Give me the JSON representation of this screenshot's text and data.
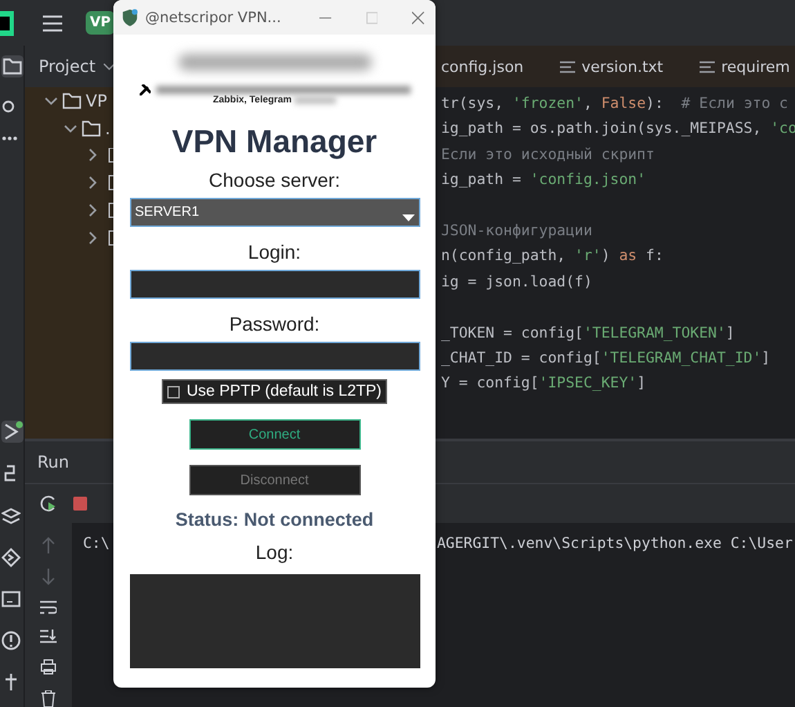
{
  "ide": {
    "top_bar": {
      "project_badge": "VP"
    },
    "project_panel": {
      "title": "Project",
      "tree": [
        {
          "label": "VP",
          "expanded": true,
          "children": [
            {
              "label": ".",
              "expanded": true
            }
          ]
        }
      ]
    },
    "editor": {
      "tabs": [
        {
          "label": "config.json"
        },
        {
          "label": "version.txt"
        },
        {
          "label": "requirem"
        }
      ],
      "lines": [
        {
          "blank_before": false,
          "tokens": [
            {
              "text": "tr(sys, ",
              "kind": "plain"
            },
            {
              "text": "'frozen'",
              "kind": "string"
            },
            {
              "text": ", ",
              "kind": "plain"
            },
            {
              "text": "False",
              "kind": "keyword"
            },
            {
              "text": "):  ",
              "kind": "plain"
            },
            {
              "text": "# Если это с",
              "kind": "comment"
            }
          ]
        },
        {
          "blank_before": false,
          "tokens": [
            {
              "text": "ig_path = os.path.join(sys._MEIPASS, ",
              "kind": "plain"
            },
            {
              "text": "'co",
              "kind": "string"
            }
          ]
        },
        {
          "blank_before": false,
          "tokens": [
            {
              "text": "Если это исходный скрипт",
              "kind": "comment"
            }
          ]
        },
        {
          "blank_before": false,
          "tokens": [
            {
              "text": "ig_path = ",
              "kind": "plain"
            },
            {
              "text": "'config.json'",
              "kind": "string"
            }
          ]
        },
        {
          "blank_before": true,
          "tokens": [
            {
              "text": "JSON-конфигурации",
              "kind": "comment"
            }
          ]
        },
        {
          "blank_before": false,
          "tokens": [
            {
              "text": "n(config_path, ",
              "kind": "plain"
            },
            {
              "text": "'r'",
              "kind": "string"
            },
            {
              "text": ") ",
              "kind": "plain"
            },
            {
              "text": "as",
              "kind": "keyword"
            },
            {
              "text": " f:",
              "kind": "plain"
            }
          ]
        },
        {
          "blank_before": false,
          "tokens": [
            {
              "text": "ig = json.load(f)",
              "kind": "plain"
            }
          ]
        },
        {
          "blank_before": true,
          "tokens": [
            {
              "text": "_TOKEN = config[",
              "kind": "plain"
            },
            {
              "text": "'TELEGRAM_TOKEN'",
              "kind": "string"
            },
            {
              "text": "]",
              "kind": "plain"
            }
          ]
        },
        {
          "blank_before": false,
          "tokens": [
            {
              "text": "_CHAT_ID = config[",
              "kind": "plain"
            },
            {
              "text": "'TELEGRAM_CHAT_ID'",
              "kind": "string"
            },
            {
              "text": "]",
              "kind": "plain"
            }
          ]
        },
        {
          "blank_before": false,
          "tokens": [
            {
              "text": "Y = config[",
              "kind": "plain"
            },
            {
              "text": "'IPSEC_KEY'",
              "kind": "string"
            },
            {
              "text": "]",
              "kind": "plain"
            }
          ]
        }
      ]
    },
    "run_panel": {
      "tab": "Run",
      "console": [
        "C:\\",
        "AGERGIT\\.venv\\Scripts\\python.exe C:\\User"
      ]
    }
  },
  "dialog": {
    "title": "@netscripor VPN...",
    "subtitle_visible": "Zabbix, Telegram",
    "heading": "VPN Manager",
    "server": {
      "label": "Choose server:",
      "value": "SERVER1"
    },
    "login": {
      "label": "Login:"
    },
    "password": {
      "label": "Password:"
    },
    "pptp": {
      "label": "Use PPTP (default is L2TP)",
      "checked": false
    },
    "buttons": [
      {
        "label": "Connect",
        "disabled": false
      },
      {
        "label": "Disconnect",
        "disabled": true
      }
    ],
    "status": "Status: Not connected",
    "log_label": "Log:"
  }
}
